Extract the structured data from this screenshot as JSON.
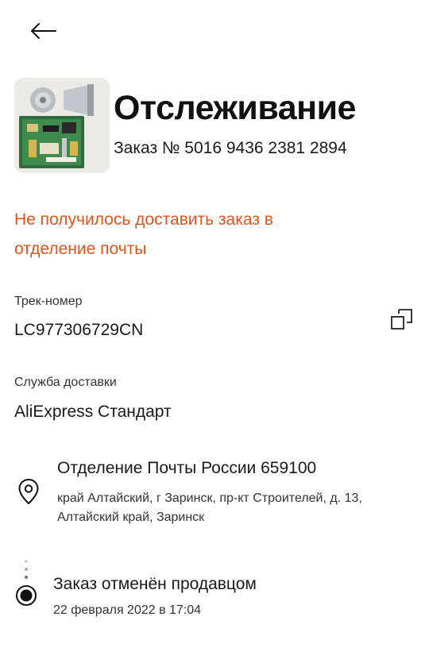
{
  "header": {
    "title": "Отслеживание",
    "order_number": "Заказ № 5016 9436 2381 2894",
    "back_icon": "arrow-left-icon"
  },
  "status": {
    "message": "Не получилось доставить заказ в отделение почты",
    "color": "#e2541b"
  },
  "tracking": {
    "label": "Трек-номер",
    "value": "LC977306729CN",
    "copy_icon": "copy-icon"
  },
  "delivery": {
    "label": "Служба доставки",
    "value": "AliExpress Стандарт"
  },
  "pickup_point": {
    "icon": "location-pin-icon",
    "name": "Отделение Почты России 659100",
    "address": "край Алтайский, г Заринск, пр-кт Строителей, д. 13, Алтайский край, Заринск"
  },
  "timeline": {
    "events": [
      {
        "title": "Заказ отменён продавцом",
        "date": "22 февраля 2022 в 17:04"
      }
    ]
  }
}
